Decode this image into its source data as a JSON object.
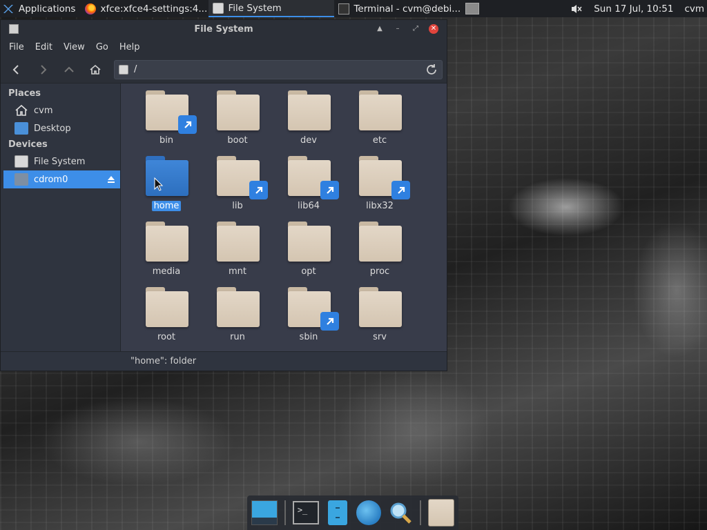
{
  "top_panel": {
    "apps_label": "Applications",
    "tasks": [
      {
        "label": "xfce:xfce4-settings:4...",
        "active": false
      },
      {
        "label": "File System",
        "active": true
      },
      {
        "label": "Terminal - cvm@debi...",
        "active": false
      }
    ],
    "datetime": "Sun 17 Jul, 10:51",
    "user": "cvm"
  },
  "window": {
    "title": "File System",
    "menu": [
      "File",
      "Edit",
      "View",
      "Go",
      "Help"
    ],
    "path": "/",
    "sidebar": {
      "places_heading": "Places",
      "places": [
        {
          "label": "cvm",
          "icon": "home-icon"
        },
        {
          "label": "Desktop",
          "icon": "desktop-folder-icon"
        }
      ],
      "devices_heading": "Devices",
      "devices": [
        {
          "label": "File System",
          "icon": "drive-icon"
        },
        {
          "label": "cdrom0",
          "icon": "optical-drive-icon",
          "selected": true
        }
      ]
    },
    "folders": [
      {
        "name": "bin",
        "link": true
      },
      {
        "name": "boot",
        "link": false
      },
      {
        "name": "dev",
        "link": false
      },
      {
        "name": "etc",
        "link": false
      },
      {
        "name": "home",
        "link": false,
        "selected": true
      },
      {
        "name": "lib",
        "link": true
      },
      {
        "name": "lib64",
        "link": true
      },
      {
        "name": "libx32",
        "link": true
      },
      {
        "name": "media",
        "link": false
      },
      {
        "name": "mnt",
        "link": false
      },
      {
        "name": "opt",
        "link": false
      },
      {
        "name": "proc",
        "link": false
      },
      {
        "name": "root",
        "link": false
      },
      {
        "name": "run",
        "link": false
      },
      {
        "name": "sbin",
        "link": true
      },
      {
        "name": "srv",
        "link": false
      }
    ],
    "status": "\"home\": folder"
  },
  "colors": {
    "accent": "#3d8ee8",
    "link_badge": "#2f80e0",
    "close_button": "#e0443c",
    "folder": "#d9ccba"
  }
}
